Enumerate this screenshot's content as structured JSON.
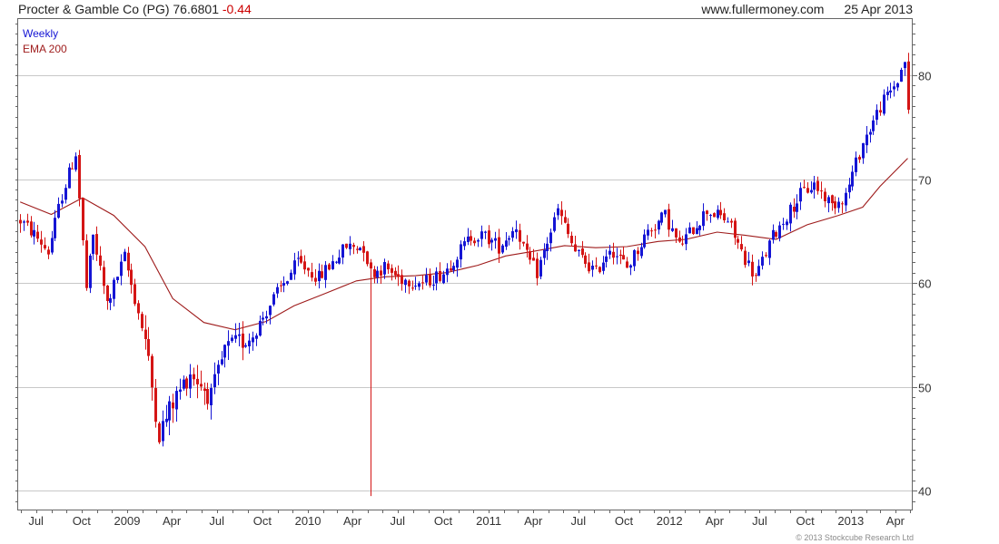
{
  "header": {
    "title": "Procter & Gamble Co (PG)",
    "price": "76.6801",
    "change": "-0.44",
    "site": "www.fullermoney.com",
    "date": "25 Apr 2013"
  },
  "footer": {
    "copyright": "© 2013 Stockcube Research Ltd"
  },
  "colors": {
    "up": "#1515d4",
    "down": "#d41515",
    "ema": "#9e1b1b",
    "grid": "#c8c8c8",
    "frame": "#666666"
  },
  "chart_data": {
    "type": "candlestick",
    "interval": "Weekly",
    "legend": [
      "Weekly",
      "EMA 200"
    ],
    "legend_position": "top-left",
    "grid": true,
    "y_axis_side": "right",
    "ylim": [
      38.2,
      85.4
    ],
    "yticks": [
      40,
      50,
      60,
      70,
      80
    ],
    "x_range": [
      "2008-05-26",
      "2013-05-06"
    ],
    "xticks": [
      {
        "label": "Jul",
        "date": "2008-07-01"
      },
      {
        "label": "Oct",
        "date": "2008-10-01"
      },
      {
        "label": "2009",
        "date": "2009-01-01"
      },
      {
        "label": "Apr",
        "date": "2009-04-01"
      },
      {
        "label": "Jul",
        "date": "2009-07-01"
      },
      {
        "label": "Oct",
        "date": "2009-10-01"
      },
      {
        "label": "2010",
        "date": "2010-01-01"
      },
      {
        "label": "Apr",
        "date": "2010-04-01"
      },
      {
        "label": "Jul",
        "date": "2010-07-01"
      },
      {
        "label": "Oct",
        "date": "2010-10-01"
      },
      {
        "label": "2011",
        "date": "2011-01-01"
      },
      {
        "label": "Apr",
        "date": "2011-04-01"
      },
      {
        "label": "Jul",
        "date": "2011-07-01"
      },
      {
        "label": "Oct",
        "date": "2011-10-01"
      },
      {
        "label": "2012",
        "date": "2012-01-01"
      },
      {
        "label": "Apr",
        "date": "2012-04-01"
      },
      {
        "label": "Jul",
        "date": "2012-07-01"
      },
      {
        "label": "Oct",
        "date": "2012-10-01"
      },
      {
        "label": "2013",
        "date": "2013-01-01"
      },
      {
        "label": "Apr",
        "date": "2013-04-01"
      }
    ],
    "price_path": [
      [
        "2008-05-30",
        66.0
      ],
      [
        "2008-07-01",
        64.5
      ],
      [
        "2008-07-25",
        63.0
      ],
      [
        "2008-08-22",
        68.5
      ],
      [
        "2008-09-19",
        72.5
      ],
      [
        "2008-10-10",
        59.5
      ],
      [
        "2008-10-24",
        64.5
      ],
      [
        "2008-11-21",
        58.0
      ],
      [
        "2008-12-26",
        62.5
      ],
      [
        "2009-02-06",
        54.5
      ],
      [
        "2009-03-06",
        45.5
      ],
      [
        "2009-04-03",
        48.5
      ],
      [
        "2009-05-08",
        51.5
      ],
      [
        "2009-06-19",
        49.0
      ],
      [
        "2009-07-17",
        53.5
      ],
      [
        "2009-09-11",
        55.0
      ],
      [
        "2009-10-23",
        58.5
      ],
      [
        "2009-12-11",
        62.0
      ],
      [
        "2010-01-22",
        60.5
      ],
      [
        "2010-03-19",
        63.5
      ],
      [
        "2010-04-23",
        63.5
      ],
      [
        "2010-05-07",
        61.0
      ],
      [
        "2010-06-04",
        61.5
      ],
      [
        "2010-07-02",
        60.5
      ],
      [
        "2010-08-20",
        60.0
      ],
      [
        "2010-10-01",
        61.0
      ],
      [
        "2010-11-26",
        64.5
      ],
      [
        "2010-12-24",
        64.5
      ],
      [
        "2011-01-21",
        63.5
      ],
      [
        "2011-02-25",
        65.5
      ],
      [
        "2011-03-18",
        62.5
      ],
      [
        "2011-04-08",
        61.0
      ],
      [
        "2011-05-20",
        67.0
      ],
      [
        "2011-06-24",
        63.0
      ],
      [
        "2011-08-05",
        61.0
      ],
      [
        "2011-09-02",
        63.5
      ],
      [
        "2011-10-07",
        61.5
      ],
      [
        "2011-11-18",
        65.0
      ],
      [
        "2011-12-23",
        66.5
      ],
      [
        "2012-01-20",
        63.5
      ],
      [
        "2012-03-16",
        67.0
      ],
      [
        "2012-04-27",
        66.0
      ],
      [
        "2012-05-25",
        63.0
      ],
      [
        "2012-06-22",
        60.5
      ],
      [
        "2012-07-27",
        64.5
      ],
      [
        "2012-09-21",
        68.5
      ],
      [
        "2012-10-19",
        69.5
      ],
      [
        "2012-11-23",
        67.5
      ],
      [
        "2012-12-21",
        68.5
      ],
      [
        "2013-01-25",
        73.5
      ],
      [
        "2013-03-01",
        77.0
      ],
      [
        "2013-04-05",
        79.5
      ],
      [
        "2013-04-19",
        81.5
      ],
      [
        "2013-04-26",
        76.68
      ]
    ],
    "ema_200": [
      [
        "2008-05-30",
        67.8
      ],
      [
        "2008-08-01",
        66.6
      ],
      [
        "2008-10-03",
        68.2
      ],
      [
        "2008-12-05",
        66.5
      ],
      [
        "2009-02-06",
        63.5
      ],
      [
        "2009-04-03",
        58.5
      ],
      [
        "2009-06-05",
        56.2
      ],
      [
        "2009-08-07",
        55.5
      ],
      [
        "2009-10-09",
        56.3
      ],
      [
        "2009-12-04",
        57.8
      ],
      [
        "2010-02-05",
        59.0
      ],
      [
        "2010-04-09",
        60.2
      ],
      [
        "2010-06-04",
        60.6
      ],
      [
        "2010-08-06",
        60.7
      ],
      [
        "2010-10-08",
        61.0
      ],
      [
        "2010-12-10",
        61.7
      ],
      [
        "2011-02-04",
        62.6
      ],
      [
        "2011-04-08",
        63.1
      ],
      [
        "2011-06-03",
        63.6
      ],
      [
        "2011-08-05",
        63.4
      ],
      [
        "2011-10-07",
        63.5
      ],
      [
        "2011-12-09",
        64.0
      ],
      [
        "2012-02-03",
        64.2
      ],
      [
        "2012-04-06",
        64.9
      ],
      [
        "2012-06-01",
        64.6
      ],
      [
        "2012-08-03",
        64.2
      ],
      [
        "2012-10-05",
        65.6
      ],
      [
        "2012-12-07",
        66.5
      ],
      [
        "2013-01-25",
        67.3
      ],
      [
        "2013-03-01",
        69.3
      ],
      [
        "2013-04-26",
        72.0
      ]
    ],
    "spikes": [
      {
        "date": "2010-05-07",
        "high": 61.5,
        "low": 39.5
      }
    ]
  }
}
